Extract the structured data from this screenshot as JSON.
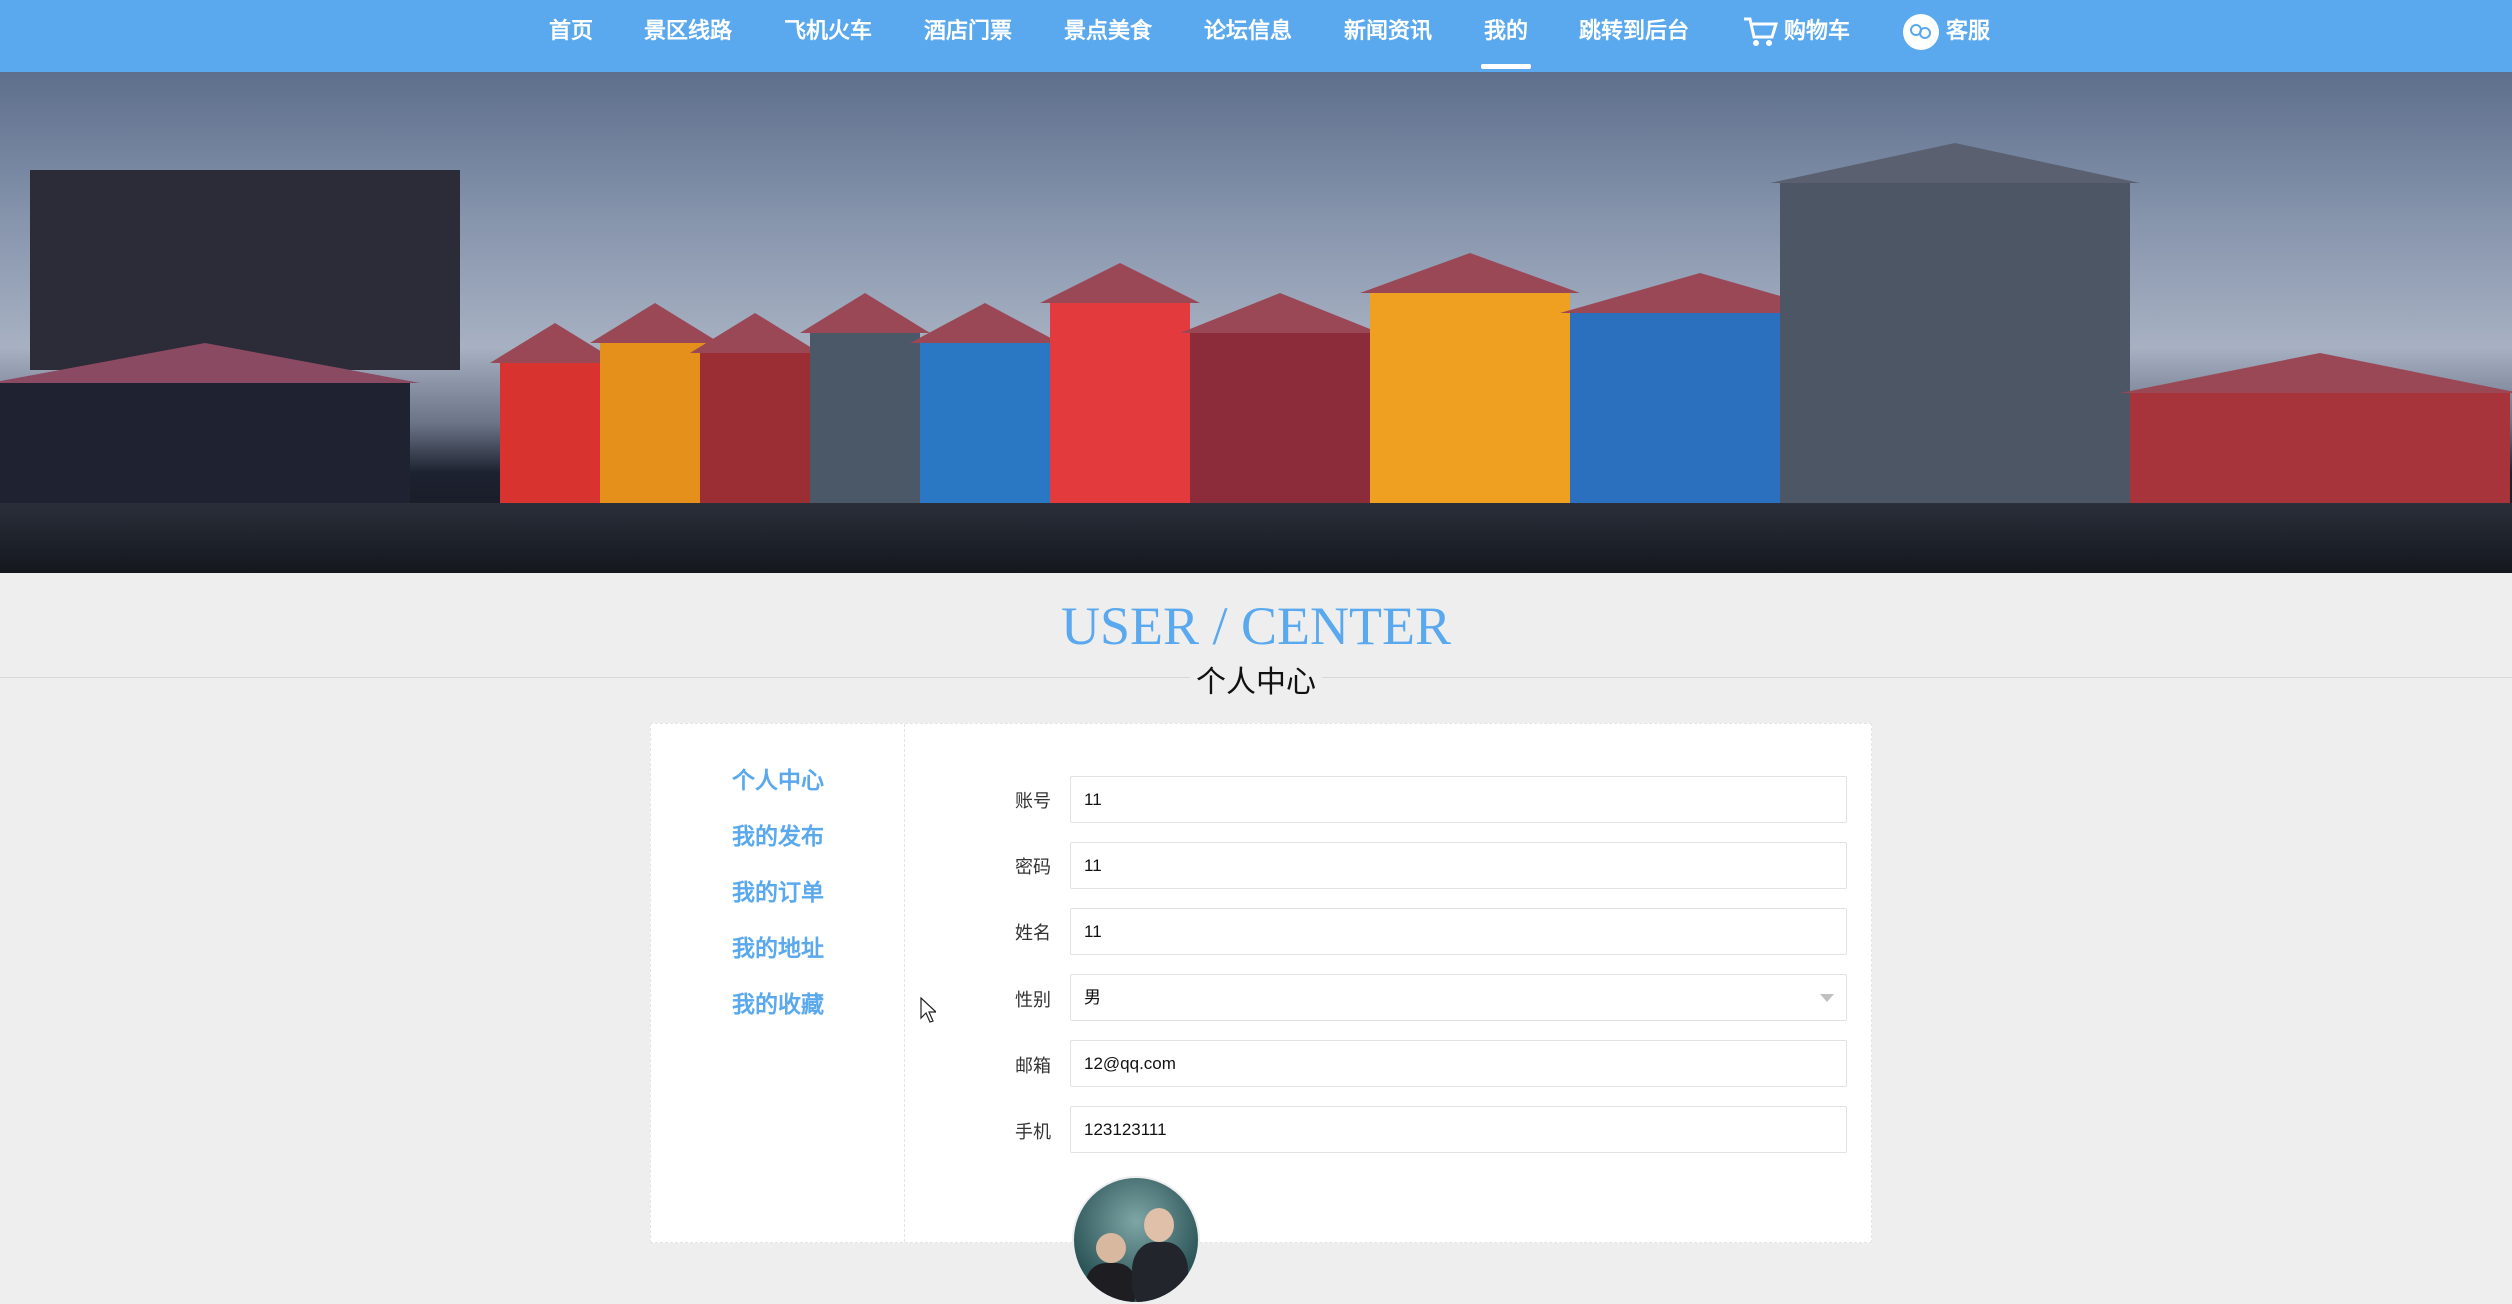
{
  "nav": {
    "items": [
      {
        "label": "首页"
      },
      {
        "label": "景区线路"
      },
      {
        "label": "飞机火车"
      },
      {
        "label": "酒店门票"
      },
      {
        "label": "景点美食"
      },
      {
        "label": "论坛信息"
      },
      {
        "label": "新闻资讯"
      },
      {
        "label": "我的",
        "active": true
      },
      {
        "label": "跳转到后台"
      },
      {
        "label": "购物车",
        "icon": "cart-icon"
      },
      {
        "label": "客服",
        "icon": "customer-service-icon"
      }
    ]
  },
  "page": {
    "title_en": "USER / CENTER",
    "title_zh": "个人中心"
  },
  "sidebar": {
    "items": [
      {
        "label": "个人中心"
      },
      {
        "label": "我的发布"
      },
      {
        "label": "我的订单"
      },
      {
        "label": "我的地址"
      },
      {
        "label": "我的收藏"
      }
    ]
  },
  "form": {
    "account": {
      "label": "账号",
      "value": "11"
    },
    "password": {
      "label": "密码",
      "value": "11"
    },
    "name": {
      "label": "姓名",
      "value": "11"
    },
    "gender": {
      "label": "性别",
      "value": "男"
    },
    "email": {
      "label": "邮箱",
      "value": "12@qq.com"
    },
    "phone": {
      "label": "手机",
      "value": "123123111"
    }
  },
  "colors": {
    "accent": "#5aa9ee",
    "background": "#eeeeee"
  }
}
